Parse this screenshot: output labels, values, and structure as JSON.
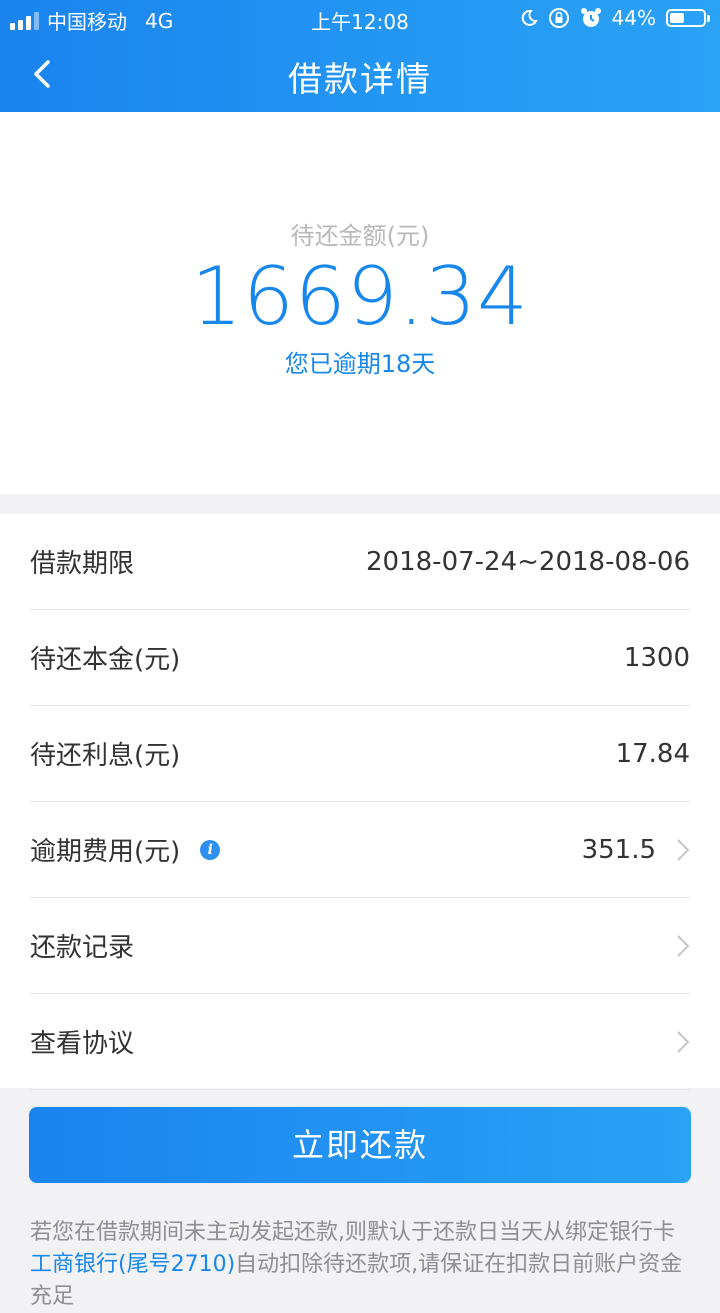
{
  "status_bar": {
    "carrier": "中国移动",
    "network": "4G",
    "time": "上午12:08",
    "battery": "44%",
    "battery_level": 0.44
  },
  "header": {
    "title": "借款详情"
  },
  "summary": {
    "label": "待还金额(元)",
    "amount": "1669.34",
    "overdue_text": "您已逾期18天"
  },
  "details": [
    {
      "label": "借款期限",
      "value": "2018-07-24~2018-08-06"
    },
    {
      "label": "待还本金(元)",
      "value": "1300"
    },
    {
      "label": "待还利息(元)",
      "value": "17.84"
    },
    {
      "label": "逾期费用(元)",
      "value": "351.5"
    },
    {
      "label": "还款记录",
      "value": ""
    },
    {
      "label": "查看协议",
      "value": ""
    }
  ],
  "action": {
    "repay_label": "立即还款"
  },
  "notice": {
    "part1": "若您在借款期间未主动发起还款,则默认于还款日当天从绑定银行卡",
    "bank": "工商银行(尾号2710)",
    "part2": "自动扣除待还款项,请保证在扣款",
    "part3": "日前账户资金充足"
  },
  "colors": {
    "primary": "#1787ec",
    "header_gradient_start": "#1a83ef",
    "header_gradient_end": "#2aa2f6",
    "background": "#f2f2f4"
  }
}
